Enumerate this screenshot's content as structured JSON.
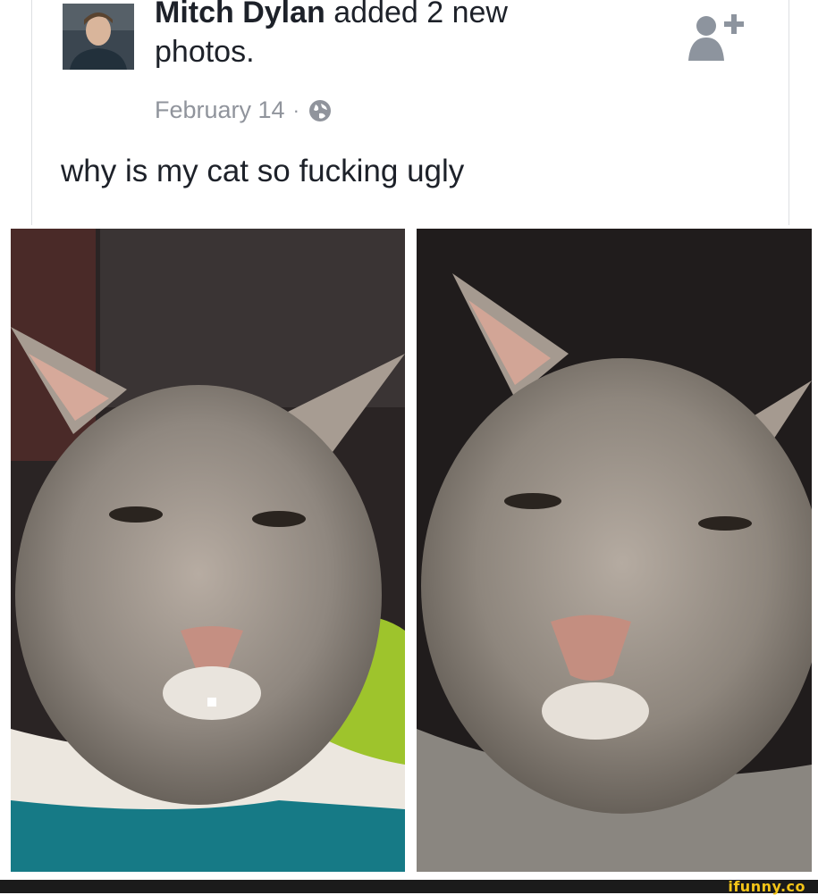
{
  "post": {
    "author": "Mitch Dylan",
    "action": "added 2 new",
    "action_line2": "photos.",
    "date": "February 14",
    "separator": "·",
    "audience_icon": "globe-icon",
    "caption": "why is my cat so fucking ugly"
  },
  "photos": [
    {
      "alt": "cat photo 1"
    },
    {
      "alt": "cat photo 2"
    }
  ],
  "header_actions": {
    "add_friend_icon": "add-friend-icon"
  },
  "watermark": {
    "text": "ifunny.co"
  },
  "colors": {
    "text": "#1d2129",
    "meta": "#90949c",
    "icon": "#8d949e",
    "watermark_bar": "#1b1b1b",
    "watermark_text": "#f5c518"
  }
}
